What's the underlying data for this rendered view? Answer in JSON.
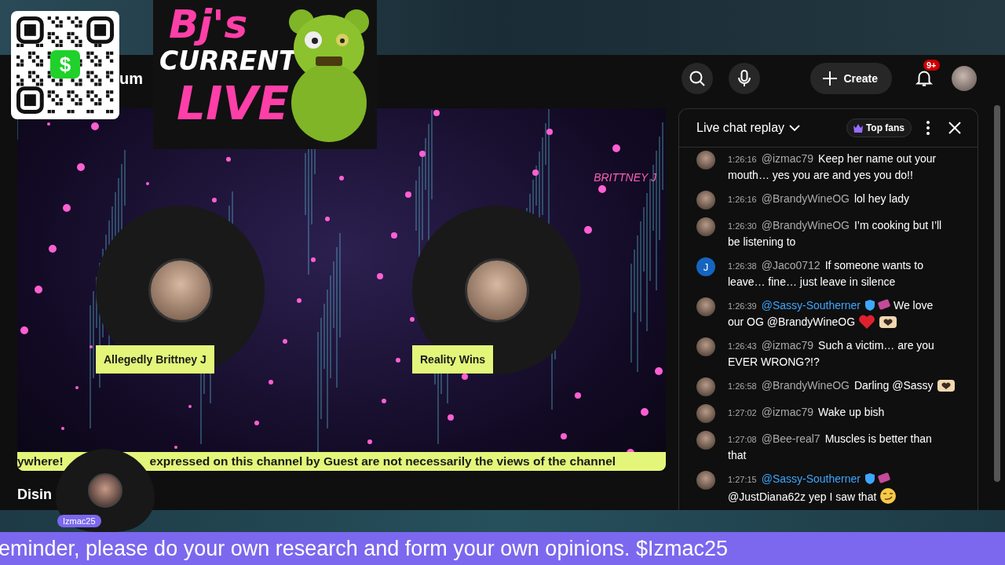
{
  "qr": {
    "center_glyph": "$"
  },
  "logo": {
    "lines": [
      "Bj's",
      "CURRENT",
      "LIVE"
    ]
  },
  "page_fragment": "um",
  "topbar": {
    "create_label": "Create",
    "notification_count": "9+"
  },
  "video": {
    "watermark": "BRITTNEY J",
    "participants": [
      {
        "name": "Allegedly Brittney J"
      },
      {
        "name": "Reality Wins"
      }
    ],
    "ticker": [
      "ywhere!",
      "expressed on this channel by Guest are not necessarily the views of the channel"
    ]
  },
  "video_title": "Disin",
  "guest": {
    "name": "Izmac25"
  },
  "chat": {
    "title": "Live chat replay",
    "filter_chip": "Top fans",
    "messages": [
      {
        "time": "1:26:16",
        "author": "@izmac79",
        "member": false,
        "text_lines": [
          "Keep her name out your",
          "mouth… yes you are and yes you do!!"
        ]
      },
      {
        "time": "1:26:16",
        "author": "@BrandyWineOG",
        "member": false,
        "text_lines": [
          "lol hey lady"
        ]
      },
      {
        "time": "1:26:30",
        "author": "@BrandyWineOG",
        "member": false,
        "text_lines": [
          "I’m cooking but I’ll",
          "be listening to"
        ]
      },
      {
        "time": "1:26:38",
        "author": "@Jaco0712",
        "member": false,
        "avatar_letter": "J",
        "text_lines": [
          "If someone wants to",
          "leave… fine… just leave in silence"
        ]
      },
      {
        "time": "1:26:39",
        "author": "@Sassy-Southerner",
        "member": true,
        "text_lines": [
          "We love",
          "our OG @BrandyWineOG"
        ],
        "emoji": [
          {
            "kind": "heart"
          },
          {
            "kind": "hands"
          }
        ]
      },
      {
        "time": "1:26:43",
        "author": "@izmac79",
        "member": false,
        "text_lines": [
          "Such a victim… are you",
          "EVER WRONG?!?"
        ]
      },
      {
        "time": "1:26:58",
        "author": "@BrandyWineOG",
        "member": false,
        "text_lines": [
          "Darling @Sassy"
        ],
        "emoji": [
          {
            "kind": "hands"
          }
        ]
      },
      {
        "time": "1:27:02",
        "author": "@izmac79",
        "member": false,
        "text_lines": [
          "Wake up bish"
        ]
      },
      {
        "time": "1:27:08",
        "author": "@Bee-real7",
        "member": false,
        "text_lines": [
          "Muscles is better than",
          "that"
        ]
      },
      {
        "time": "1:27:15",
        "author": "@Sassy-Southerner",
        "member": true,
        "wrap_before": true,
        "text_lines": [
          "@JustDiana62z yep I saw that"
        ],
        "emoji": [
          {
            "kind": "smirk"
          }
        ]
      }
    ]
  },
  "bottom_ticker": "eminder, please do your own research and form your own opinions. $Izmac25"
}
